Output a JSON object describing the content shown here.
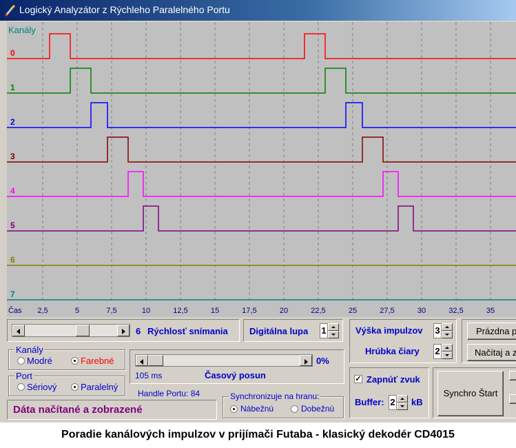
{
  "window": {
    "title": "Logický Analyzátor z Rýchleho Paralelného Portu"
  },
  "plot": {
    "channels_label": "Kanály",
    "time_label": "Čas",
    "channels": [
      {
        "label": "0",
        "color": "#ff0000"
      },
      {
        "label": "1",
        "color": "#008000"
      },
      {
        "label": "2",
        "color": "#0000ff"
      },
      {
        "label": "3",
        "color": "#800000"
      },
      {
        "label": "4",
        "color": "#ff00ff"
      },
      {
        "label": "5",
        "color": "#800080"
      },
      {
        "label": "6",
        "color": "#808000"
      },
      {
        "label": "7",
        "color": "#008080"
      }
    ],
    "time_ticks": [
      "2,5",
      "5",
      "7,5",
      "10",
      "12,5",
      "15",
      "17,5",
      "20",
      "22,5",
      "25",
      "27,5",
      "30",
      "32,5",
      "35"
    ],
    "pulses": [
      [
        [
          3.0,
          4.5
        ],
        [
          21.5,
          23.0
        ]
      ],
      [
        [
          4.5,
          6.0
        ],
        [
          23.0,
          24.5
        ]
      ],
      [
        [
          6.0,
          7.2
        ],
        [
          24.5,
          25.7
        ]
      ],
      [
        [
          7.2,
          8.7
        ],
        [
          25.7,
          27.2
        ]
      ],
      [
        [
          8.7,
          9.8
        ],
        [
          27.2,
          28.3
        ]
      ],
      [
        [
          9.8,
          10.9
        ],
        [
          28.3,
          29.4
        ]
      ],
      [],
      []
    ]
  },
  "speed": {
    "value": "6",
    "label": "Rýchlosť snímania"
  },
  "zoom": {
    "label": "Digitálna lupa",
    "value": "1"
  },
  "pulse_height": {
    "label": "Výška impulzov",
    "value": "3"
  },
  "line_width": {
    "label": "Hrúbka čiary",
    "value": "2"
  },
  "buttons": {
    "empty": "Prázdna p",
    "load": "Načítaj a z",
    "sync_start": "Synchro Štart"
  },
  "channels_group": {
    "legend": "Kanály",
    "blue": "Modré",
    "color": "Farebné",
    "selected": "Farebné"
  },
  "port_group": {
    "legend": "Port",
    "serial": "Sériový",
    "parallel": "Paralelný",
    "selected": "Paralelný"
  },
  "time_shift": {
    "percent": "0%",
    "ms": "105 ms",
    "label": "Časový posun"
  },
  "handle": "Handle Portu: 84",
  "sync_group": {
    "legend": "Synchronizuje na hranu:",
    "rising": "Nábežnú",
    "falling": "Dobežnú",
    "selected": "Nábežnú"
  },
  "status": "Dáta načítané a zobrazené",
  "sound": {
    "label": "Zapnúť zvuk",
    "checked": true
  },
  "buffer": {
    "label": "Buffer:",
    "value": "2",
    "unit": "kB"
  },
  "caption": "Poradie kanálových impulzov v prijímači Futaba - klasický dekodér CD4015"
}
